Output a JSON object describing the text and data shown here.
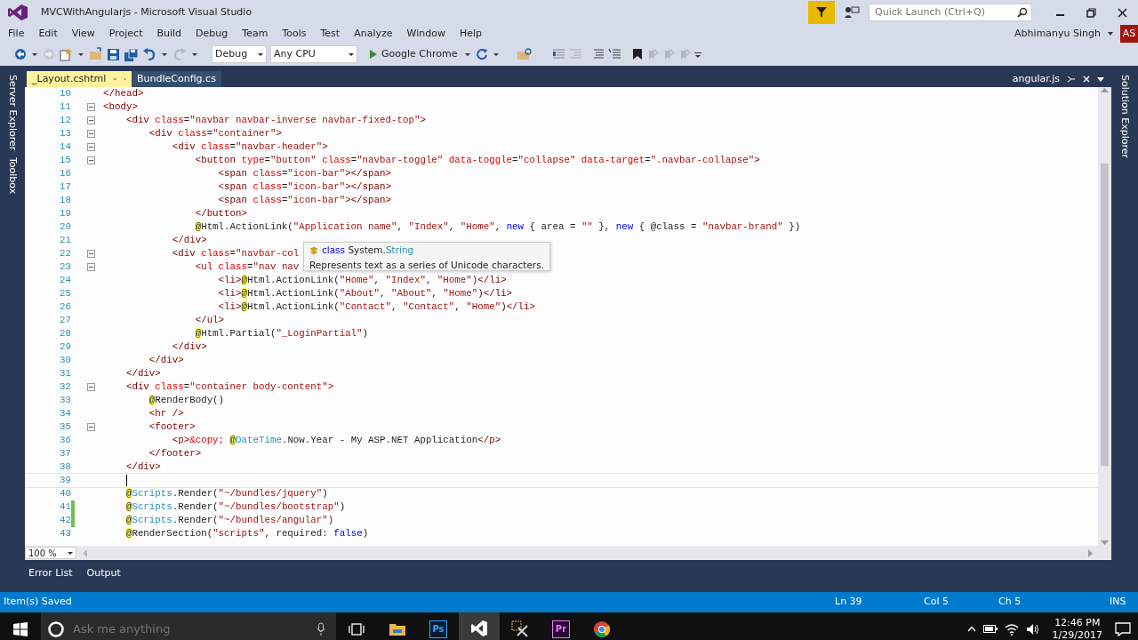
{
  "window": {
    "title": "MVCWithAngularjs - Microsoft Visual Studio"
  },
  "quick_launch": {
    "placeholder": "Quick Launch (Ctrl+Q)"
  },
  "menu": [
    "File",
    "Edit",
    "View",
    "Project",
    "Build",
    "Debug",
    "Team",
    "Tools",
    "Test",
    "Analyze",
    "Window",
    "Help"
  ],
  "account": {
    "name": "Abhimanyu Singh",
    "initials": "AS"
  },
  "toolbar": {
    "configuration": "Debug",
    "platform": "Any CPU",
    "run_target": "Google Chrome"
  },
  "side_tabs_left": [
    "Server Explorer",
    "Toolbox"
  ],
  "side_tabs_right": [
    "Solution Explorer"
  ],
  "doc_tabs": [
    {
      "label": "_Layout.cshtml",
      "selected": true
    },
    {
      "label": "BundleConfig.cs",
      "selected": false
    }
  ],
  "preview_tab": {
    "label": "angular.js"
  },
  "editor": {
    "lines": [
      {
        "number": "10",
        "fold": false,
        "changed": false,
        "current": false,
        "tokens": [
          {
            "kind": "tag",
            "text": "</head>"
          }
        ]
      },
      {
        "number": "11",
        "fold": true,
        "changed": false,
        "current": false,
        "tokens": [
          {
            "kind": "tag",
            "text": "<body>"
          }
        ]
      },
      {
        "number": "12",
        "fold": true,
        "changed": false,
        "current": false,
        "tokens": [
          {
            "kind": "tag",
            "text": "    <div "
          },
          {
            "kind": "attr",
            "text": "class"
          },
          {
            "kind": "plain",
            "text": "="
          },
          {
            "kind": "str",
            "text": "\"navbar navbar-inverse navbar-fixed-top\""
          },
          {
            "kind": "tag",
            "text": ">"
          }
        ]
      },
      {
        "number": "13",
        "fold": true,
        "changed": false,
        "current": false,
        "tokens": [
          {
            "kind": "tag",
            "text": "        <div "
          },
          {
            "kind": "attr",
            "text": "class"
          },
          {
            "kind": "plain",
            "text": "="
          },
          {
            "kind": "str",
            "text": "\"container\""
          },
          {
            "kind": "tag",
            "text": ">"
          }
        ]
      },
      {
        "number": "14",
        "fold": true,
        "changed": false,
        "current": false,
        "tokens": [
          {
            "kind": "tag",
            "text": "            <div "
          },
          {
            "kind": "attr",
            "text": "class"
          },
          {
            "kind": "plain",
            "text": "="
          },
          {
            "kind": "str",
            "text": "\"navbar-header\""
          },
          {
            "kind": "tag",
            "text": ">"
          }
        ]
      },
      {
        "number": "15",
        "fold": true,
        "changed": false,
        "current": false,
        "tokens": [
          {
            "kind": "tag",
            "text": "                <button "
          },
          {
            "kind": "attr",
            "text": "type"
          },
          {
            "kind": "plain",
            "text": "="
          },
          {
            "kind": "str",
            "text": "\"button\""
          },
          {
            "kind": "attr",
            "text": " class"
          },
          {
            "kind": "plain",
            "text": "="
          },
          {
            "kind": "str",
            "text": "\"navbar-toggle\""
          },
          {
            "kind": "attr",
            "text": " data-toggle"
          },
          {
            "kind": "plain",
            "text": "="
          },
          {
            "kind": "str",
            "text": "\"collapse\""
          },
          {
            "kind": "attr",
            "text": " data-target"
          },
          {
            "kind": "plain",
            "text": "="
          },
          {
            "kind": "str",
            "text": "\".navbar-collapse\""
          },
          {
            "kind": "tag",
            "text": ">"
          }
        ]
      },
      {
        "number": "16",
        "fold": false,
        "changed": false,
        "current": false,
        "tokens": [
          {
            "kind": "tag",
            "text": "                    <span "
          },
          {
            "kind": "attr",
            "text": "class"
          },
          {
            "kind": "plain",
            "text": "="
          },
          {
            "kind": "str",
            "text": "\"icon-bar\""
          },
          {
            "kind": "tag",
            "text": "></span>"
          }
        ]
      },
      {
        "number": "17",
        "fold": false,
        "changed": false,
        "current": false,
        "tokens": [
          {
            "kind": "tag",
            "text": "                    <span "
          },
          {
            "kind": "attr",
            "text": "class"
          },
          {
            "kind": "plain",
            "text": "="
          },
          {
            "kind": "str",
            "text": "\"icon-bar\""
          },
          {
            "kind": "tag",
            "text": "></span>"
          }
        ]
      },
      {
        "number": "18",
        "fold": false,
        "changed": false,
        "current": false,
        "tokens": [
          {
            "kind": "tag",
            "text": "                    <span "
          },
          {
            "kind": "attr",
            "text": "class"
          },
          {
            "kind": "plain",
            "text": "="
          },
          {
            "kind": "str",
            "text": "\"icon-bar\""
          },
          {
            "kind": "tag",
            "text": "></span>"
          }
        ]
      },
      {
        "number": "19",
        "fold": false,
        "changed": false,
        "current": false,
        "tokens": [
          {
            "kind": "tag",
            "text": "                </button>"
          }
        ]
      },
      {
        "number": "20",
        "fold": false,
        "changed": false,
        "current": false,
        "tokens": [
          {
            "kind": "at",
            "text": "                @"
          },
          {
            "kind": "plain",
            "text": "Html.ActionLink("
          },
          {
            "kind": "str",
            "text": "\"Application name\""
          },
          {
            "kind": "plain",
            "text": ", "
          },
          {
            "kind": "str",
            "text": "\"Index\""
          },
          {
            "kind": "plain",
            "text": ", "
          },
          {
            "kind": "str",
            "text": "\"Home\""
          },
          {
            "kind": "plain",
            "text": ", "
          },
          {
            "kind": "kw",
            "text": "new"
          },
          {
            "kind": "plain",
            "text": " { area = "
          },
          {
            "kind": "str",
            "text": "\"\""
          },
          {
            "kind": "plain",
            "text": " }, "
          },
          {
            "kind": "kw",
            "text": "new"
          },
          {
            "kind": "plain",
            "text": " { @class = "
          },
          {
            "kind": "str",
            "text": "\"navbar-brand\""
          },
          {
            "kind": "plain",
            "text": " })"
          }
        ]
      },
      {
        "number": "21",
        "fold": false,
        "changed": false,
        "current": false,
        "tokens": [
          {
            "kind": "tag",
            "text": "            </div>"
          }
        ]
      },
      {
        "number": "22",
        "fold": true,
        "changed": false,
        "current": false,
        "tokens": [
          {
            "kind": "tag",
            "text": "            <div "
          },
          {
            "kind": "attr",
            "text": "class"
          },
          {
            "kind": "plain",
            "text": "="
          },
          {
            "kind": "str",
            "text": "\"navbar-col"
          }
        ]
      },
      {
        "number": "23",
        "fold": true,
        "changed": false,
        "current": false,
        "tokens": [
          {
            "kind": "tag",
            "text": "                <ul "
          },
          {
            "kind": "attr",
            "text": "class"
          },
          {
            "kind": "plain",
            "text": "="
          },
          {
            "kind": "str",
            "text": "\"nav nav"
          }
        ]
      },
      {
        "number": "24",
        "fold": false,
        "changed": false,
        "current": false,
        "tokens": [
          {
            "kind": "tag",
            "text": "                    <li>"
          },
          {
            "kind": "at",
            "text": "@"
          },
          {
            "kind": "plain",
            "text": "Html.ActionLink("
          },
          {
            "kind": "str",
            "text": "\"Home\""
          },
          {
            "kind": "plain",
            "text": ", "
          },
          {
            "kind": "str",
            "text": "\"Index\""
          },
          {
            "kind": "plain",
            "text": ", "
          },
          {
            "kind": "str",
            "text": "\"Home\""
          },
          {
            "kind": "plain",
            "text": ")"
          },
          {
            "kind": "tag",
            "text": "</li>"
          }
        ]
      },
      {
        "number": "25",
        "fold": false,
        "changed": false,
        "current": false,
        "tokens": [
          {
            "kind": "tag",
            "text": "                    <li>"
          },
          {
            "kind": "at",
            "text": "@"
          },
          {
            "kind": "plain",
            "text": "Html.ActionLink("
          },
          {
            "kind": "str",
            "text": "\"About\""
          },
          {
            "kind": "plain",
            "text": ", "
          },
          {
            "kind": "str",
            "text": "\"About\""
          },
          {
            "kind": "plain",
            "text": ", "
          },
          {
            "kind": "str",
            "text": "\"Home\""
          },
          {
            "kind": "plain",
            "text": ")"
          },
          {
            "kind": "tag",
            "text": "</li>"
          }
        ]
      },
      {
        "number": "26",
        "fold": false,
        "changed": false,
        "current": false,
        "tokens": [
          {
            "kind": "tag",
            "text": "                    <li>"
          },
          {
            "kind": "at",
            "text": "@"
          },
          {
            "kind": "plain",
            "text": "Html.ActionLink("
          },
          {
            "kind": "str",
            "text": "\"Contact\""
          },
          {
            "kind": "plain",
            "text": ", "
          },
          {
            "kind": "str",
            "text": "\"Contact\""
          },
          {
            "kind": "plain",
            "text": ", "
          },
          {
            "kind": "str",
            "text": "\"Home\""
          },
          {
            "kind": "plain",
            "text": ")"
          },
          {
            "kind": "tag",
            "text": "</li>"
          }
        ]
      },
      {
        "number": "27",
        "fold": false,
        "changed": false,
        "current": false,
        "tokens": [
          {
            "kind": "tag",
            "text": "                </ul>"
          }
        ]
      },
      {
        "number": "28",
        "fold": false,
        "changed": false,
        "current": false,
        "tokens": [
          {
            "kind": "at",
            "text": "                @"
          },
          {
            "kind": "plain",
            "text": "Html.Partial("
          },
          {
            "kind": "str",
            "text": "\"_LoginPartial\""
          },
          {
            "kind": "plain",
            "text": ")"
          }
        ]
      },
      {
        "number": "29",
        "fold": false,
        "changed": false,
        "current": false,
        "tokens": [
          {
            "kind": "tag",
            "text": "            </div>"
          }
        ]
      },
      {
        "number": "30",
        "fold": false,
        "changed": false,
        "current": false,
        "tokens": [
          {
            "kind": "tag",
            "text": "        </div>"
          }
        ]
      },
      {
        "number": "31",
        "fold": false,
        "changed": false,
        "current": false,
        "tokens": [
          {
            "kind": "tag",
            "text": "    </div>"
          }
        ]
      },
      {
        "number": "32",
        "fold": true,
        "changed": false,
        "current": false,
        "tokens": [
          {
            "kind": "tag",
            "text": "    <div "
          },
          {
            "kind": "attr",
            "text": "class"
          },
          {
            "kind": "plain",
            "text": "="
          },
          {
            "kind": "str",
            "text": "\"container body-content\""
          },
          {
            "kind": "tag",
            "text": ">"
          }
        ]
      },
      {
        "number": "33",
        "fold": false,
        "changed": false,
        "current": false,
        "tokens": [
          {
            "kind": "at",
            "text": "        @"
          },
          {
            "kind": "plain",
            "text": "RenderBody()"
          }
        ]
      },
      {
        "number": "34",
        "fold": false,
        "changed": false,
        "current": false,
        "tokens": [
          {
            "kind": "tag",
            "text": "        <hr />"
          }
        ]
      },
      {
        "number": "35",
        "fold": true,
        "changed": false,
        "current": false,
        "tokens": [
          {
            "kind": "tag",
            "text": "        <footer>"
          }
        ]
      },
      {
        "number": "36",
        "fold": false,
        "changed": false,
        "current": false,
        "tokens": [
          {
            "kind": "tag",
            "text": "            <p>"
          },
          {
            "kind": "ent",
            "text": "&copy;"
          },
          {
            "kind": "at",
            "text": " @"
          },
          {
            "kind": "type",
            "text": "DateTime"
          },
          {
            "kind": "plain",
            "text": ".Now.Year - My ASP.NET Application"
          },
          {
            "kind": "tag",
            "text": "</p>"
          }
        ]
      },
      {
        "number": "37",
        "fold": false,
        "changed": false,
        "current": false,
        "tokens": [
          {
            "kind": "tag",
            "text": "        </footer>"
          }
        ]
      },
      {
        "number": "38",
        "fold": false,
        "changed": false,
        "current": false,
        "tokens": [
          {
            "kind": "tag",
            "text": "    </div>"
          }
        ]
      },
      {
        "number": "39",
        "fold": false,
        "changed": false,
        "current": true
      },
      {
        "number": "40",
        "fold": false,
        "changed": false,
        "current": false,
        "tokens": [
          {
            "kind": "at",
            "text": "    @"
          },
          {
            "kind": "type",
            "text": "Scripts"
          },
          {
            "kind": "plain",
            "text": ".Render("
          },
          {
            "kind": "str",
            "text": "\"~/bundles/jquery\""
          },
          {
            "kind": "plain",
            "text": ")"
          }
        ]
      },
      {
        "number": "41",
        "fold": false,
        "changed": true,
        "current": false,
        "tokens": [
          {
            "kind": "at",
            "text": "    @"
          },
          {
            "kind": "type",
            "text": "Scripts"
          },
          {
            "kind": "plain",
            "text": ".Render("
          },
          {
            "kind": "str",
            "text": "\"~/bundles/bootstrap\""
          },
          {
            "kind": "plain",
            "text": ")"
          }
        ]
      },
      {
        "number": "42",
        "fold": false,
        "changed": true,
        "current": false,
        "tokens": [
          {
            "kind": "at",
            "text": "    @"
          },
          {
            "kind": "type",
            "text": "Scripts"
          },
          {
            "kind": "plain",
            "text": ".Render("
          },
          {
            "kind": "str",
            "text": "\"~/bundles/angular\""
          },
          {
            "kind": "plain",
            "text": ")"
          }
        ]
      },
      {
        "number": "43",
        "fold": false,
        "changed": false,
        "current": false,
        "tokens": [
          {
            "kind": "at",
            "text": "    @"
          },
          {
            "kind": "plain",
            "text": "RenderSection("
          },
          {
            "kind": "str",
            "text": "\"scripts\""
          },
          {
            "kind": "plain",
            "text": ", required: "
          },
          {
            "kind": "kw",
            "text": "false"
          },
          {
            "kind": "plain",
            "text": ")"
          }
        ]
      }
    ]
  },
  "tooltip": {
    "keyword": "class",
    "namespace": "System.",
    "type": "String",
    "description": "Represents text as a series of Unicode characters."
  },
  "zoom": "100 %",
  "bottom_tabs": [
    "Error List",
    "Output"
  ],
  "status_bar": {
    "message": "Item(s) Saved",
    "line": "Ln 39",
    "column": "Col 5",
    "char": "Ch 5",
    "mode": "INS"
  },
  "taskbar": {
    "search_placeholder": "Ask me anything",
    "apps": [
      {
        "kind": "folder"
      },
      {
        "kind": "ps",
        "label": "Ps"
      },
      {
        "kind": "vs",
        "selected": true
      },
      {
        "kind": "tool"
      },
      {
        "kind": "pr",
        "label": "Pr"
      },
      {
        "kind": "chrome"
      }
    ],
    "time": "12:46 PM",
    "date": "1/29/2017"
  }
}
